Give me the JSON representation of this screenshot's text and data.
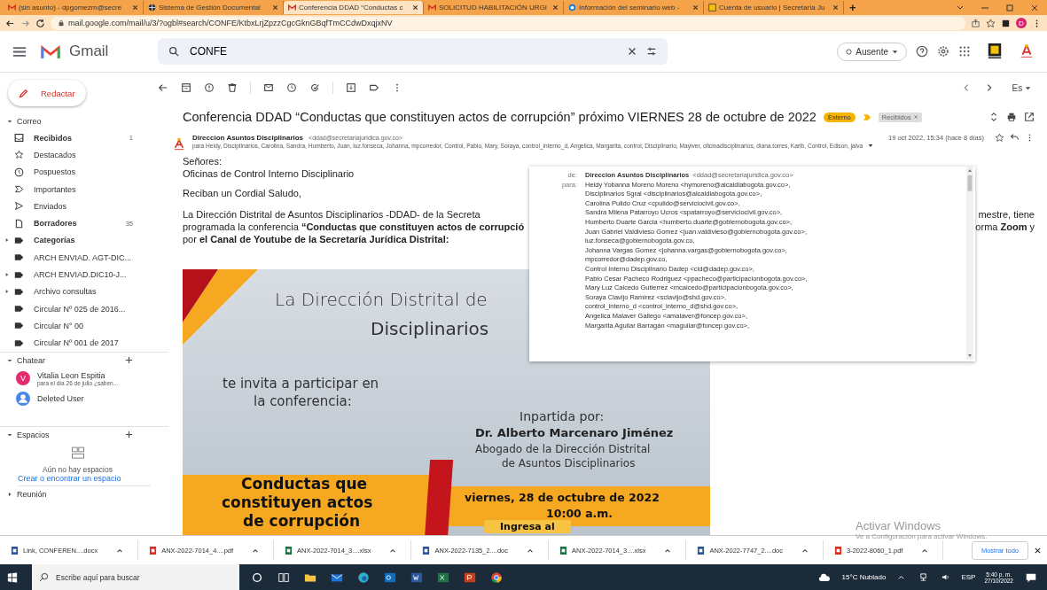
{
  "browser": {
    "tabs": [
      {
        "title": "(sin asunto) - dpgomezm@secre",
        "kind": "gmail",
        "selected": false
      },
      {
        "title": "Sistema de Gestión Documental",
        "kind": "globe",
        "selected": false
      },
      {
        "title": "Conferencia DDAD “Conductas c",
        "kind": "gmail",
        "selected": true
      },
      {
        "title": "SOLICITUD HABILITACIÓN URGI",
        "kind": "gmail",
        "selected": false
      },
      {
        "title": "Información del seminario web -",
        "kind": "webex",
        "selected": false
      },
      {
        "title": "Cuenta de usuario | Secretaría Ju",
        "kind": "crest",
        "selected": false
      }
    ],
    "new_tab": "+",
    "url": "mail.google.com/mail/u/3/?ogbl#search/CONFE/KtbxLrjZpzzCgcGknGBqfTmCCdwDxqjxNV",
    "profile_initial": "D"
  },
  "gmail": {
    "logo": "Gmail",
    "search": {
      "value": "CONFE"
    },
    "status": "Ausente"
  },
  "sidebar": {
    "compose": "Redactar",
    "mail_section": "Correo",
    "items": [
      {
        "label": "Recibidos",
        "kind": "inbox",
        "bold": true,
        "count": "1",
        "has_children": false
      },
      {
        "label": "Destacados",
        "kind": "star",
        "bold": false,
        "has_children": false
      },
      {
        "label": "Pospuestos",
        "kind": "clock",
        "bold": false,
        "has_children": false
      },
      {
        "label": "Importantes",
        "kind": "important",
        "bold": false,
        "has_children": false
      },
      {
        "label": "Enviados",
        "kind": "send",
        "bold": false,
        "has_children": false
      },
      {
        "label": "Borradores",
        "kind": "draft",
        "bold": true,
        "count": "35",
        "has_children": false
      },
      {
        "label": "Categorías",
        "kind": "label",
        "bold": true,
        "has_children": true
      },
      {
        "label": "ARCH ENVIAD. AGT-DIC...",
        "kind": "label",
        "bold": false,
        "has_children": false
      },
      {
        "label": "ARCH ENVIAD.DIC10-J...",
        "kind": "label",
        "bold": false,
        "has_children": true
      },
      {
        "label": "Archivo consultas",
        "kind": "label",
        "bold": false,
        "has_children": true
      },
      {
        "label": "Circular Nº 025 de 2016...",
        "kind": "label",
        "bold": false,
        "has_children": false
      },
      {
        "label": "Circular N° 00",
        "kind": "label",
        "bold": false,
        "has_children": false
      },
      {
        "label": "Circular Nº 001 de 2017",
        "kind": "label",
        "bold": false,
        "has_children": false
      }
    ],
    "chat_section": "Chatear",
    "chats": [
      {
        "name": "Vitalia Leon Espitia",
        "preview": "para el día 26 de julio ¿saben...",
        "avatar": "V",
        "color": "#e52c6f"
      },
      {
        "name": "Deleted User",
        "color": "#4a86e8"
      }
    ],
    "spaces_section": "Espacios",
    "spaces_empty": "Aún no hay espacios",
    "spaces_link": "Crear o encontrar un espacio",
    "meet_section": "Reunión"
  },
  "pager": "Es",
  "email": {
    "subject": "Conferencia DDAD “Conductas que constituyen actos de corrupción” próximo VIERNES 28 de octubre de 2022",
    "tags": [
      {
        "label": "Externo",
        "kind": "external"
      },
      {
        "label": "Recibidos",
        "kind": "label"
      }
    ],
    "sender": "Direccion Asuntos Disciplinarios",
    "sender_email": "<ddad@secretariajuridica.gov.co>",
    "date": "19 oct 2022, 15:34 (hace 8 días)",
    "to_line": "para Heidy, Disciplinarios, Carolina, Sandra, Humberto, Juan, luz.fonseca, Johanna, mpcorredor, Control, Pablo, Mary, Soraya, control_interno_d, Angelica, Margarita, control, Disciplinario, Mayiver, oficinadisciplinarios, diana.torres, Karib, Control, Edison, jaiva",
    "details": {
      "from_label": "de:",
      "to_label": "para:",
      "from_name": "Direccion Asuntos Disciplinarios",
      "from_email": "<ddad@secretariajuridica.gov.co>",
      "recipients": [
        "Heidy Yobanna Moreno Moreno <hymoreno@alcaldiabogota.gov.co>,",
        "Disciplinarios Sgral <disciplinarios@alcaldiabogota.gov.co>,",
        "Carolina Pulido Cruz <cpulido@serviciocivil.gov.co>,",
        "Sandra Milena Patarroyo Ucros <spatarroyo@serviciocivil.gov.co>,",
        "Humberto Duarte Garcia <humberto.duarte@gobiernobogota.gov.co>,",
        "Juan Gabriel Valdivieso Gomez <juan.valdivieso@gobiernobogota.gov.co>,",
        "luz.fonseca@gobiernobogota.gov.co,",
        "Johanna Vargas Gomez <johanna.vargas@gobiernobogota.gov.co>,",
        "mpcorredor@dadep.gov.co,",
        "Control Interno Disciplinario Dadep <cid@dadep.gov.co>,",
        "Pablo Cesar Pacheco Rodriguez <ppacheco@participacionbogota.gov.co>,",
        "Mary Luz Caicedo Gutierrez <mcaicedo@participacionbogota.gov.co>,",
        "Soraya Clavijo Ramirez <sclavijo@shd.gov.co>,",
        "control_interno_d <control_interno_d@shd.gov.co>,",
        "Angelica Malaver Gallego <amalaver@foncep.gov.co>,",
        "Margarita Aguilar Barragán <maguilar@foncep.gov.co>,"
      ]
    },
    "greeting": [
      "Señores:",
      "Oficinas de Control Interno Disciplinario"
    ],
    "salutation": "Reciban un Cordial Saludo,",
    "paragraph": [
      {
        "left": "La Dirección Distrital de Asuntos Disciplinarios -DDAD- de la Secreta",
        "right": "mestre, tiene"
      },
      {
        "left": "programada la conferencia **“Conductas que constituyen actos de corrupció**",
        "right": "orma **Zoom** y"
      },
      {
        "left": "por **el Canal de Youtube de la Secretaría Jurídica Distrital:**"
      }
    ],
    "flyer": {
      "title": [
        "La Dirección Distrital de",
        "Disciplinarios"
      ],
      "invite": [
        "te invita a participar en",
        "la conferencia:"
      ],
      "given_by": "Inpartida por:",
      "speaker": "Dr. Alberto Marcenaro Jiménez",
      "speaker_role": [
        "Abogado de la Dirección Distrital",
        "de Asuntos Disciplinarios"
      ],
      "topic": [
        "Conductas que",
        "constituyen actos",
        "de corrupción"
      ],
      "date": "viernes, 28 de octubre de 2022",
      "time": "10:00 a.m.",
      "button": "Ingresa al"
    }
  },
  "activation": {
    "title": "Activar Windows",
    "hint": "Ve a Configuración para activar Windows."
  },
  "downloads": {
    "items": [
      {
        "name": "Link, CONFEREN....docx",
        "kind": "word"
      },
      {
        "name": "ANX-2022-7014_4....pdf",
        "kind": "pdf"
      },
      {
        "name": "ANX-2022-7014_3....xlsx",
        "kind": "excel"
      },
      {
        "name": "ANX-2022-7135_2....doc",
        "kind": "word"
      },
      {
        "name": "ANX-2022-7014_3....xlsx",
        "kind": "excel"
      },
      {
        "name": "ANX-2022-7747_2....doc",
        "kind": "word"
      },
      {
        "name": "3-2022-8060_1.pdf",
        "kind": "pdf"
      }
    ],
    "show_all": "Mostrar todo"
  },
  "taskbar": {
    "search": {
      "placeholder": "Escribe aquí para buscar"
    },
    "weather": "15°C Nublado",
    "language": "ESP",
    "time": "5:40 p. m.",
    "date": "27/10/2022"
  }
}
